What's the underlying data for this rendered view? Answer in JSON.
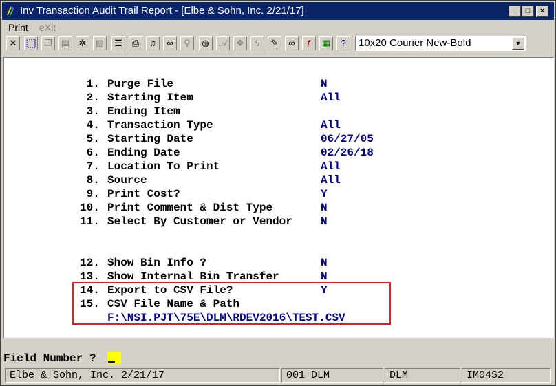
{
  "window": {
    "title": "Inv Transaction Audit Trail Report - [Elbe & Sohn, Inc. 2/21/17]",
    "minimize": "_",
    "maximize": "□",
    "close": "×"
  },
  "menu": {
    "print": "Print",
    "exit": "eXit"
  },
  "toolbar": {
    "font_select": "10x20 Courier New-Bold",
    "font_select_arrow": "▼",
    "icons": [
      "close-icon",
      "select-icon",
      "copy-icon",
      "paste-icon",
      "settings-icon",
      "properties-icon",
      "list-icon",
      "print-setup-icon",
      "bell-icon",
      "binoculars-icon",
      "zoom-icon",
      "globe-icon",
      "font-icon",
      "color-icon",
      "lightning-icon",
      "script-icon",
      "link-icon",
      "function-icon",
      "calculator-icon",
      "help-icon"
    ]
  },
  "fields": [
    {
      "num": " 1.",
      "label": "Purge File",
      "value": "N"
    },
    {
      "num": " 2.",
      "label": "Starting Item",
      "value": "All"
    },
    {
      "num": " 3.",
      "label": "Ending Item",
      "value": ""
    },
    {
      "num": " 4.",
      "label": "Transaction Type",
      "value": "All"
    },
    {
      "num": " 5.",
      "label": "Starting Date",
      "value": "06/27/05"
    },
    {
      "num": " 6.",
      "label": "Ending Date",
      "value": "02/26/18"
    },
    {
      "num": " 7.",
      "label": "Location To Print",
      "value": "All"
    },
    {
      "num": " 8.",
      "label": "Source",
      "value": "All"
    },
    {
      "num": " 9.",
      "label": "Print Cost?",
      "value": "Y"
    },
    {
      "num": "10.",
      "label": "Print Comment & Dist Type",
      "value": "N"
    },
    {
      "num": "11.",
      "label": "Select By Customer or Vendor",
      "value": "N"
    },
    {
      "num": "12.",
      "label": "Show Bin Info ?",
      "value": "N"
    },
    {
      "num": "13.",
      "label": "Show Internal Bin Transfer",
      "value": "N"
    },
    {
      "num": "14.",
      "label": "Export to CSV File?",
      "value": "Y"
    },
    {
      "num": "15.",
      "label": "CSV File Name & Path",
      "value": ""
    }
  ],
  "csv_path": "F:\\NSI.PJT\\75E\\DLM\\RDEV2016\\TEST.CSV",
  "prompt": "Field Number ?",
  "status": {
    "company": "Elbe & Sohn, Inc. 2/21/17",
    "session": "001 DLM",
    "user": "DLM",
    "program": "IM04S2"
  }
}
